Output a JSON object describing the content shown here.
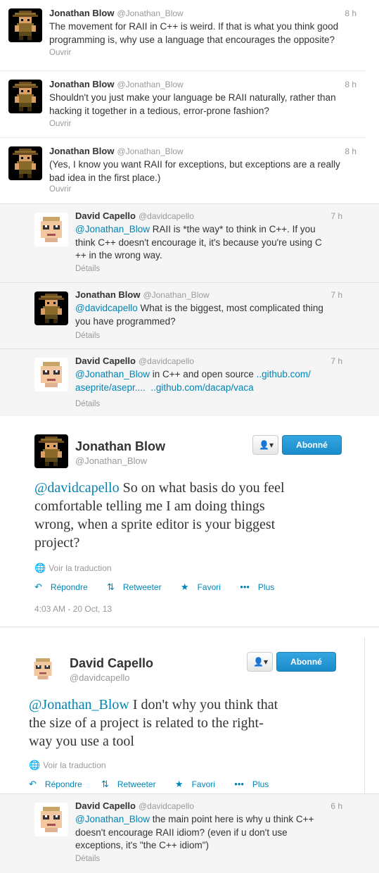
{
  "tweets": [
    {
      "name": "Jonathan Blow",
      "handle": "@Jonathan_Blow",
      "time": "8 h",
      "line1": "The movement for RAII in C++ is weird.  If that is what you think good",
      "line2": "programming is, why use a language that encourages the opposite?",
      "action": "Ouvrir"
    },
    {
      "name": "Jonathan Blow",
      "handle": "@Jonathan_Blow",
      "time": "8 h",
      "line1": "Shouldn't you just make your language be RAII naturally, rather than",
      "line2": "hacking it together in a tedious, error-prone fashion?",
      "action": "Ouvrir"
    },
    {
      "name": "Jonathan Blow",
      "handle": "@Jonathan_Blow",
      "time": "8 h",
      "line1": "(Yes, I know you want RAII for exceptions, but exceptions are a really",
      "line2": "bad idea in the first place.)",
      "action": "Ouvrir"
    }
  ],
  "replies": [
    {
      "name": "David Capello",
      "handle": "@davidcapello",
      "time": "7 h",
      "mention": "@Jonathan_Blow",
      "line1": " RAII is *the way* to think in C++. If you",
      "line2": "think C++ doesn't encourage it, it's because you're using C",
      "line3": "++ in the wrong way.",
      "action": "Détails"
    },
    {
      "name": "Jonathan Blow",
      "handle": "@Jonathan_Blow",
      "time": "7 h",
      "mention": "@davidcapello",
      "line1": " What is the biggest, most complicated thing",
      "line2": "you have programmed?",
      "action": "Détails"
    },
    {
      "name": "David Capello",
      "handle": "@davidcapello",
      "time": "7 h",
      "mention": "@Jonathan_Blow",
      "line1": " in C++ and open source ",
      "link1": "..github.com/",
      "link2": "aseprite/asepr....",
      "link3": "..github.com/dacap/vaca",
      "action": "Détails"
    }
  ],
  "focus1": {
    "name": "Jonathan Blow",
    "handle": "@Jonathan_Blow",
    "follow": "Abonné",
    "mention": "@davidcapello",
    "line1": " So on what basis do you feel",
    "line2": "comfortable telling me I am doing things",
    "line3": "wrong, when a sprite editor is your biggest",
    "line4": "project?",
    "translate": "Voir la traduction",
    "reply": "Répondre",
    "retweet": "Retweeter",
    "fav": "Favori",
    "more": "Plus",
    "date": "4:03 AM - 20 Oct, 13"
  },
  "focus2": {
    "name": "David Capello",
    "handle": "@davidcapello",
    "follow": "Abonné",
    "mention": "@Jonathan_Blow",
    "line1": " I don't why you think that",
    "line2": "the size of a project is related to the right-",
    "line3": "way you use a tool",
    "translate": "Voir la traduction",
    "reply": "Répondre",
    "retweet": "Retweeter",
    "fav": "Favori",
    "more": "Plus"
  },
  "last": {
    "name": "David Capello",
    "handle": "@davidcapello",
    "time": "6 h",
    "mention": "@Jonathan_Blow",
    "line1": " the main point here is why u think C++",
    "line2": "doesn't encourage RAII idiom? (even if u don't use",
    "line3": "exceptions, it's \"the C++ idiom\")",
    "action": "Détails"
  }
}
